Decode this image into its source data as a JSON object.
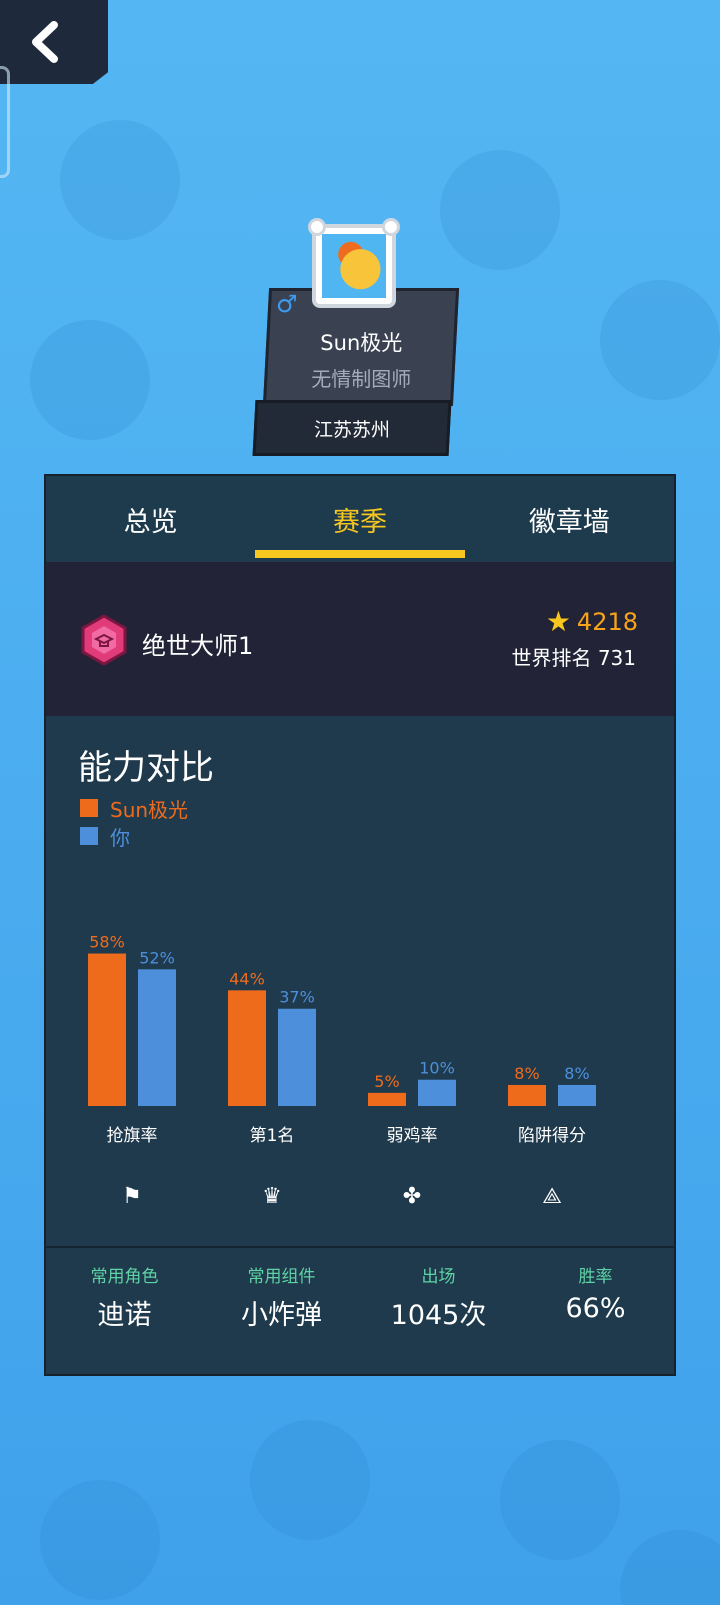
{
  "colors": {
    "accent": "#f7c61f",
    "series_a": "#ef6b1c",
    "series_b": "#4d8fdb",
    "panel": "#1f3a4c"
  },
  "header": {
    "back_icon": "chevron-left-icon"
  },
  "profile": {
    "name": "Sun极光",
    "title": "无情制图师",
    "location": "江苏苏州",
    "gender_icon": "male-icon"
  },
  "tabs": [
    {
      "label": "总览",
      "active": false
    },
    {
      "label": "赛季",
      "active": true
    },
    {
      "label": "徽章墙",
      "active": false
    }
  ],
  "rank": {
    "name": "绝世大师1",
    "score": "4218",
    "world_rank": "世界排名 731"
  },
  "compare": {
    "title": "能力对比"
  },
  "chart_data": {
    "type": "bar",
    "title": "能力对比",
    "categories": [
      "抢旗率",
      "第1名",
      "弱鸡率",
      "陷阱得分"
    ],
    "series": [
      {
        "name": "Sun极光",
        "values": [
          58,
          44,
          5,
          8
        ]
      },
      {
        "name": "你",
        "values": [
          52,
          37,
          10,
          8
        ]
      }
    ],
    "value_format": "%",
    "ylim": [
      0,
      70
    ],
    "legend": "top-left",
    "grid": false,
    "category_icons": [
      "flag-icon",
      "crown-icon",
      "chicken-icon",
      "trap-icon"
    ]
  },
  "stats": [
    {
      "label": "常用角色",
      "value": "迪诺"
    },
    {
      "label": "常用组件",
      "value": "小炸弹"
    },
    {
      "label": "出场",
      "value": "1045次"
    },
    {
      "label": "胜率",
      "value": "66%"
    }
  ]
}
